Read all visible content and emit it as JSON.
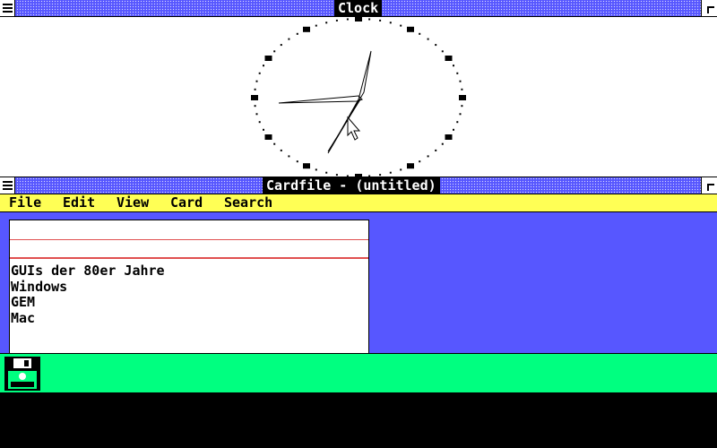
{
  "clock": {
    "title": "Clock"
  },
  "cardfile": {
    "title": "Cardfile - (untitled)",
    "menu": [
      "File",
      "Edit",
      "View",
      "Card",
      "Search"
    ],
    "card_lines": [
      "GUIs der 80er Jahre",
      "Windows",
      "GEM",
      "Mac"
    ]
  },
  "icons": {
    "clock_window_system_menu": "system-menu-icon",
    "cardfile_window_system_menu": "system-menu-icon",
    "minimized_app": "floppy-disk-icon"
  },
  "colors": {
    "titlebar": "#5757ff",
    "menubar": "#ffff55",
    "workspace": "#5757ff",
    "icon_strip": "#00ff80",
    "card_rule": "#e05050"
  }
}
